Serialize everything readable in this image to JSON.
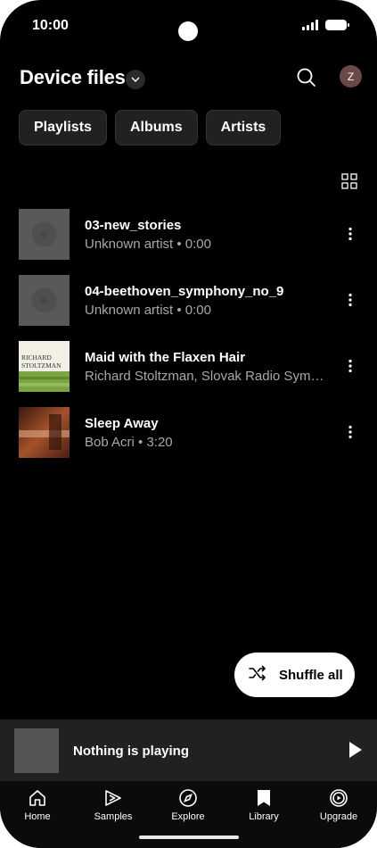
{
  "status": {
    "time": "10:00"
  },
  "header": {
    "title": "Device files",
    "avatar_initial": "Z"
  },
  "chips": [
    "Playlists",
    "Albums",
    "Artists"
  ],
  "tracks": [
    {
      "title": "03-new_stories",
      "subtitle": "Unknown artist • 0:00",
      "art": "placeholder-disc"
    },
    {
      "title": "04-beethoven_symphony_no_9",
      "subtitle": "Unknown artist • 0:00",
      "art": "placeholder-disc"
    },
    {
      "title": "Maid with the Flaxen Hair",
      "subtitle": "Richard Stoltzman, Slovak Radio Sympho…",
      "art": "album-cover-stoltzman",
      "art_text": [
        "RICHARD",
        "STOLTZMAN"
      ]
    },
    {
      "title": "Sleep Away",
      "subtitle": "Bob Acri • 3:20",
      "art": "album-cover-piano"
    }
  ],
  "shuffle": {
    "label": "Shuffle all"
  },
  "mini_player": {
    "text": "Nothing is playing"
  },
  "nav": [
    {
      "label": "Home",
      "icon": "home-icon"
    },
    {
      "label": "Samples",
      "icon": "samples-icon"
    },
    {
      "label": "Explore",
      "icon": "compass-icon"
    },
    {
      "label": "Library",
      "icon": "library-icon"
    },
    {
      "label": "Upgrade",
      "icon": "upgrade-icon"
    }
  ],
  "colors": {
    "background": "#000000",
    "surface": "#212121",
    "secondary_text": "#a8a8a8",
    "accent": "#ffffff"
  }
}
